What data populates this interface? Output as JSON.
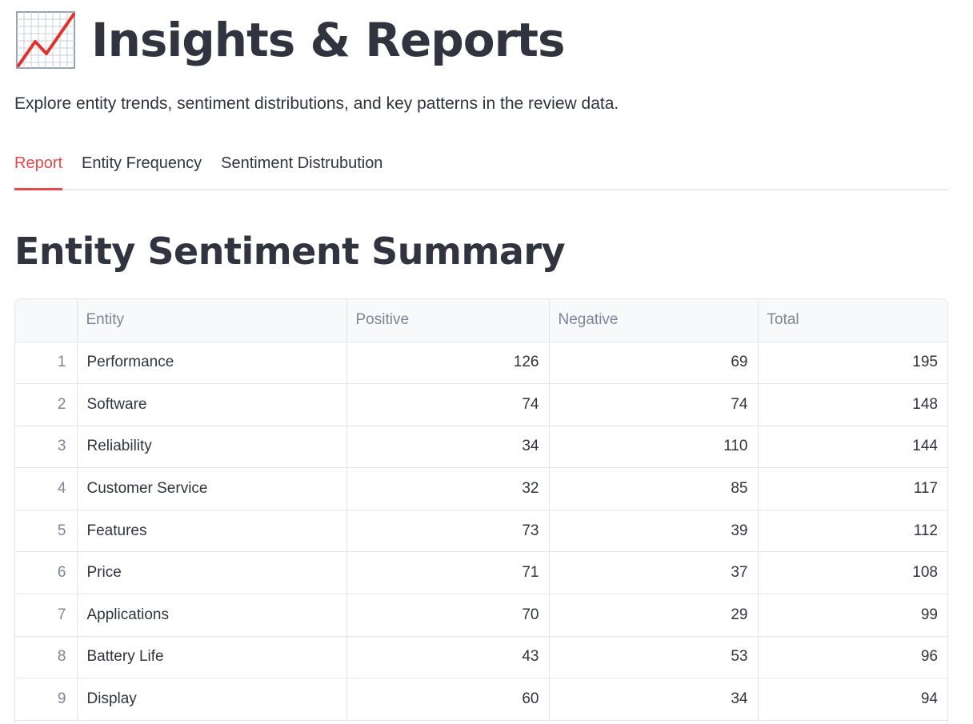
{
  "header": {
    "icon": "chart-increasing-icon",
    "title": "Insights & Reports",
    "subtitle": "Explore entity trends, sentiment distributions, and key patterns in the review data."
  },
  "tabs": [
    {
      "label": "Report",
      "active": true
    },
    {
      "label": "Entity Frequency",
      "active": false
    },
    {
      "label": "Sentiment Distrubution",
      "active": false
    }
  ],
  "section": {
    "title": "Entity Sentiment Summary"
  },
  "table": {
    "columns": [
      "",
      "Entity",
      "Positive",
      "Negative",
      "Total"
    ],
    "rows": [
      {
        "index": "1",
        "entity": "Performance",
        "positive": "126",
        "negative": "69",
        "total": "195"
      },
      {
        "index": "2",
        "entity": "Software",
        "positive": "74",
        "negative": "74",
        "total": "148"
      },
      {
        "index": "3",
        "entity": "Reliability",
        "positive": "34",
        "negative": "110",
        "total": "144"
      },
      {
        "index": "4",
        "entity": "Customer Service",
        "positive": "32",
        "negative": "85",
        "total": "117"
      },
      {
        "index": "5",
        "entity": "Features",
        "positive": "73",
        "negative": "39",
        "total": "112"
      },
      {
        "index": "6",
        "entity": "Price",
        "positive": "71",
        "negative": "37",
        "total": "108"
      },
      {
        "index": "7",
        "entity": "Applications",
        "positive": "70",
        "negative": "29",
        "total": "99"
      },
      {
        "index": "8",
        "entity": "Battery Life",
        "positive": "43",
        "negative": "53",
        "total": "96"
      },
      {
        "index": "9",
        "entity": "Display",
        "positive": "60",
        "negative": "34",
        "total": "94"
      }
    ]
  },
  "colors": {
    "accent": "#e8474b",
    "text": "#31333f",
    "muted": "#808495",
    "border": "#e4e5ea",
    "header_bg": "#f8f9fb"
  }
}
